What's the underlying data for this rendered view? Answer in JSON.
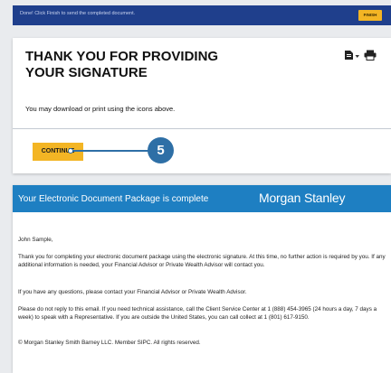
{
  "top_bar": {
    "message": "Done! Click Finish to send the completed document.",
    "finish_label": "FINISH"
  },
  "card": {
    "title": "THANK YOU FOR PROVIDING YOUR SIGNATURE",
    "subtitle": "You may download or print using the icons above.",
    "continue_label": "CONTINUE"
  },
  "callout": {
    "step": "5"
  },
  "email": {
    "header_text": "Your Electronic Document Package is complete",
    "brand": "Morgan Stanley",
    "greeting": "John Sample,",
    "paragraph1": "Thank you for completing your electronic document package using the electronic signature. At this time, no further action is required by you. If any additional information is needed, your Financial Advisor or Private Wealth Advisor will contact you.",
    "paragraph2": "If you have any questions, please contact your Financial Advisor or Private Wealth Advisor.",
    "paragraph3": "Please do not reply to this email. If you need technical assistance, call the Client Service Center at 1 (888) 454-3965 (24 hours a day, 7 days a week) to speak with a Representative. If you are outside the United States, you can call collect at 1 (801) 617-9150.",
    "footer": "© Morgan Stanley Smith Barney LLC. Member SIPC. All rights reserved."
  },
  "colors": {
    "accent_yellow": "#f3b524",
    "top_bar_blue": "#1f3f8c",
    "email_header_blue": "#1e7fc2",
    "callout_blue": "#2e6fa6"
  }
}
